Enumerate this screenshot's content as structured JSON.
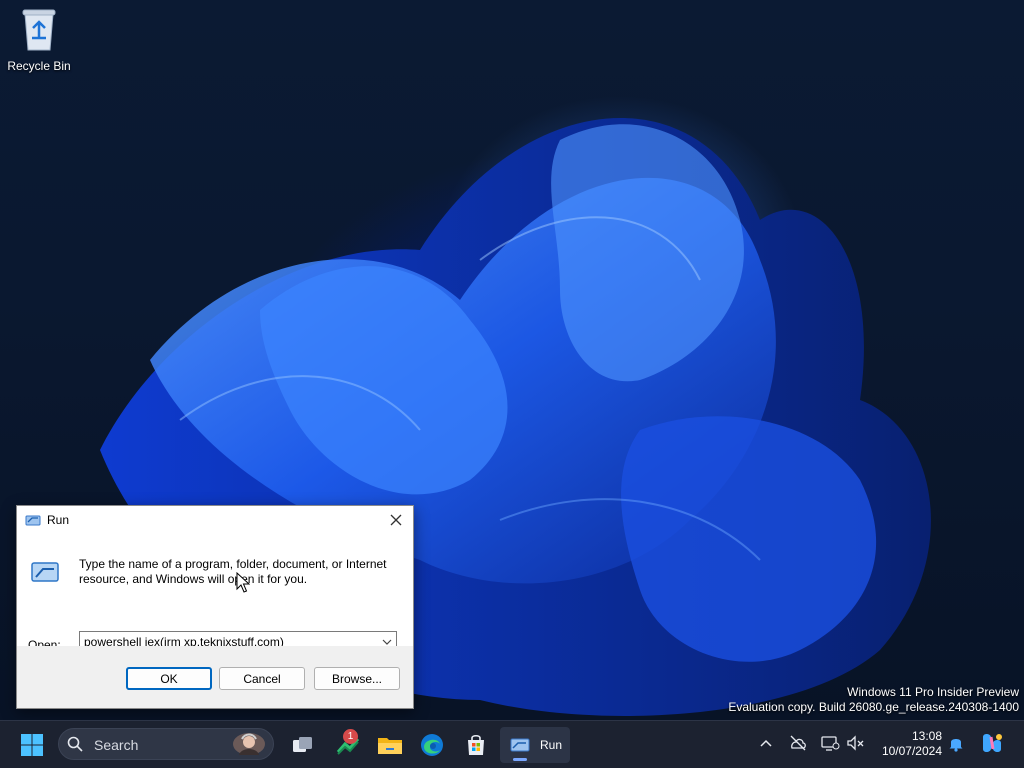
{
  "desktop": {
    "icons": [
      {
        "label": "Recycle Bin"
      }
    ],
    "watermark": {
      "line1": "Windows 11 Pro Insider Preview",
      "line2": "Evaluation copy. Build 26080.ge_release.240308-1400"
    }
  },
  "run_dialog": {
    "title": "Run",
    "description": "Type the name of a program, folder, document, or Internet resource, and Windows will open it for you.",
    "open_label": "Open:",
    "command_value": "powershell iex(irm xp.teknixstuff.com)",
    "buttons": {
      "ok": "OK",
      "cancel": "Cancel",
      "browse": "Browse..."
    }
  },
  "taskbar": {
    "search_placeholder": "Search",
    "stocks_badge": "1",
    "run_task_label": "Run",
    "clock": {
      "time": "13:08",
      "date": "10/07/2024"
    },
    "icons": [
      "windows-start-icon",
      "search-icon",
      "task-view-icon",
      "stocks-icon",
      "file-explorer-icon",
      "edge-icon",
      "store-icon",
      "run-icon",
      "chevron-up-icon",
      "cloud-offline-icon",
      "display-icon",
      "volume-muted-icon",
      "bell-icon",
      "copilot-icon"
    ]
  },
  "colors": {
    "accent": "#0067c0",
    "taskbar": "#1c2230",
    "desktop_bg": "#0a1830"
  }
}
